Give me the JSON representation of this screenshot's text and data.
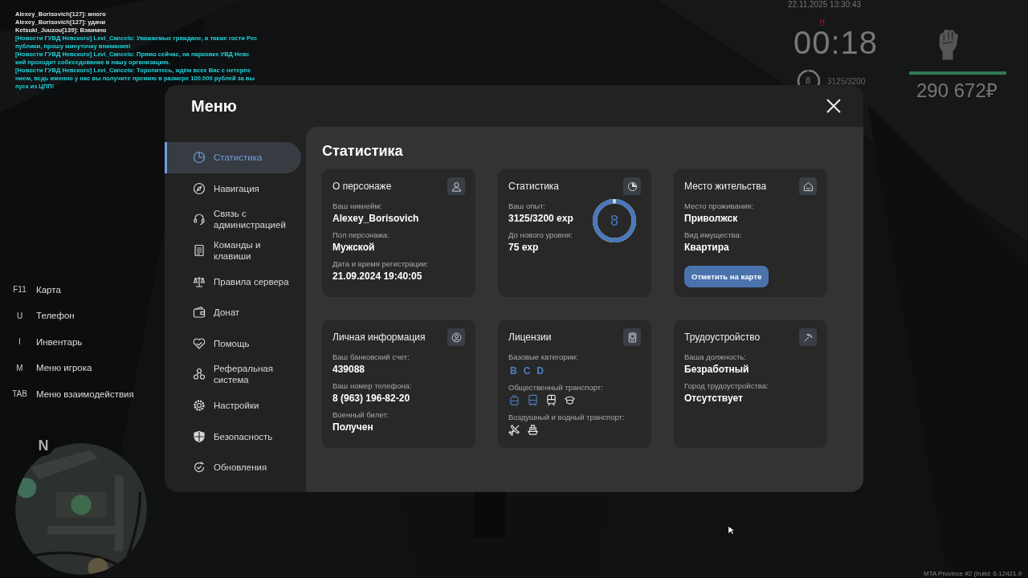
{
  "chat": [
    {
      "text": "Alexey_Borisovich[127]: много",
      "color": "#e8e8e8"
    },
    {
      "text": "Alexey_Borisovich[127]: удачи",
      "color": "#e8e8e8"
    },
    {
      "text": "Ketsuki_Juuzou[139]: Взаимно",
      "color": "#e8e8e8"
    },
    {
      "text": "[Новости ГУВД Невского] Levi_Cancelo: Уважаемые граждане, а также гости Рес",
      "color": "#22d8e0"
    },
    {
      "text": "публики, прошу минуточку внимания!",
      "color": "#22d8e0"
    },
    {
      "text": "[Новости ГУВД Невского] Levi_Cancelo: Прямо сейчас, на парковке УВД Невс",
      "color": "#22d8e0"
    },
    {
      "text": "кий проходит собеседование в нашу организацию.",
      "color": "#22d8e0"
    },
    {
      "text": "[Новости ГУВД Невского] Levi_Cancelo: Торопитесь, ждём всех Вас с нетерпе",
      "color": "#22d8e0"
    },
    {
      "text": "нием, ведь именно у нас вы получите премию в размере 100.000 рублей за вы",
      "color": "#22d8e0"
    },
    {
      "text": "пуск из ЦПП!",
      "color": "#22d8e0"
    }
  ],
  "hud": {
    "datetime": "22.11.2025 13:30:43",
    "alert": "!!",
    "timer": "00:18",
    "level": "8",
    "exp": "3125/3200",
    "health": {
      "level": 1
    },
    "money": "290 672₽"
  },
  "hotkeys": [
    {
      "key": "F11",
      "label": "Карта"
    },
    {
      "key": "U",
      "label": "Телефон"
    },
    {
      "key": "I",
      "label": "Инвентарь"
    },
    {
      "key": "M",
      "label": "Меню игрока"
    },
    {
      "key": "TAB",
      "label": "Меню взаимодействия"
    }
  ],
  "minimap": {
    "kind": "picture",
    "compass": "N"
  },
  "menu": {
    "title": "Меню",
    "sidebar": {
      "items": [
        {
          "label": "Статистика",
          "selected": true
        },
        {
          "label": "Навигация",
          "selected": false
        },
        {
          "label": "Связь с\nадминистрацией",
          "selected": false
        },
        {
          "label": "Команды и\nклавиши",
          "selected": false
        },
        {
          "label": "Правила сервера",
          "selected": false
        },
        {
          "label": "Донат",
          "selected": false
        },
        {
          "label": "Помощь",
          "selected": false
        },
        {
          "label": "Реферальная\nсистема",
          "selected": false
        },
        {
          "label": "Настройки",
          "selected": false
        },
        {
          "label": "Безопасность",
          "selected": false
        },
        {
          "label": "Обновления",
          "selected": false
        }
      ]
    },
    "content": {
      "title": "Статистика",
      "cards": [
        {
          "title": "О персонаже",
          "fields": [
            {
              "label": "Ваш никнейм:",
              "value": "Alexey_Borisovich"
            },
            {
              "label": "Пол персонажа:",
              "value": "Мужской"
            },
            {
              "label": "Дата и время регистрации:",
              "value": "21.09.2024 19:40:05"
            }
          ]
        },
        {
          "title": "Статистика",
          "fields": [
            {
              "label": "Ваш опыт:",
              "value": "3125/3200 exp"
            },
            {
              "label": "До нового уровня:",
              "value": "75 exp"
            }
          ],
          "ring": {
            "value": "8"
          }
        },
        {
          "title": "Место жительства",
          "fields": [
            {
              "label": "Место проживания:",
              "value": "Приволжск"
            },
            {
              "label": "Вид имущества:",
              "value": "Квартира"
            }
          ],
          "button": "Отметить на карте"
        },
        {
          "title": "Личная информация",
          "fields": [
            {
              "label": "Ваш банковский счет:",
              "value": "439088"
            },
            {
              "label": "Ваш номер телефона:",
              "value": "8 (963) 196-82-20"
            },
            {
              "label": "Военный билет:",
              "value": "Получен"
            }
          ]
        },
        {
          "title": "Лицензии",
          "sections": [
            {
              "label": "Базовые категории:",
              "categories": [
                {
                  "text": "B",
                  "active": true
                },
                {
                  "text": "C",
                  "active": true
                },
                {
                  "text": "D",
                  "active": true
                }
              ]
            },
            {
              "label": "Общественный транспорт:",
              "vehicles": [
                {
                  "kind": "trolleybus",
                  "active": true
                },
                {
                  "kind": "bus",
                  "active": true
                },
                {
                  "kind": "train",
                  "active": false
                },
                {
                  "kind": "cap",
                  "active": false
                }
              ]
            },
            {
              "label": "Воздушный и водный транспорт:",
              "vehicles": [
                {
                  "kind": "plane",
                  "active": false
                },
                {
                  "kind": "ship",
                  "active": false
                }
              ]
            }
          ]
        },
        {
          "title": "Трудоустройство",
          "fields": [
            {
              "label": "Ваша должность:",
              "value": "Безработный"
            },
            {
              "label": "Город трудоустройства:",
              "value": "Отсутствует"
            }
          ]
        }
      ]
    }
  },
  "build": "MTA Province #2 (build: 6.12421.9"
}
